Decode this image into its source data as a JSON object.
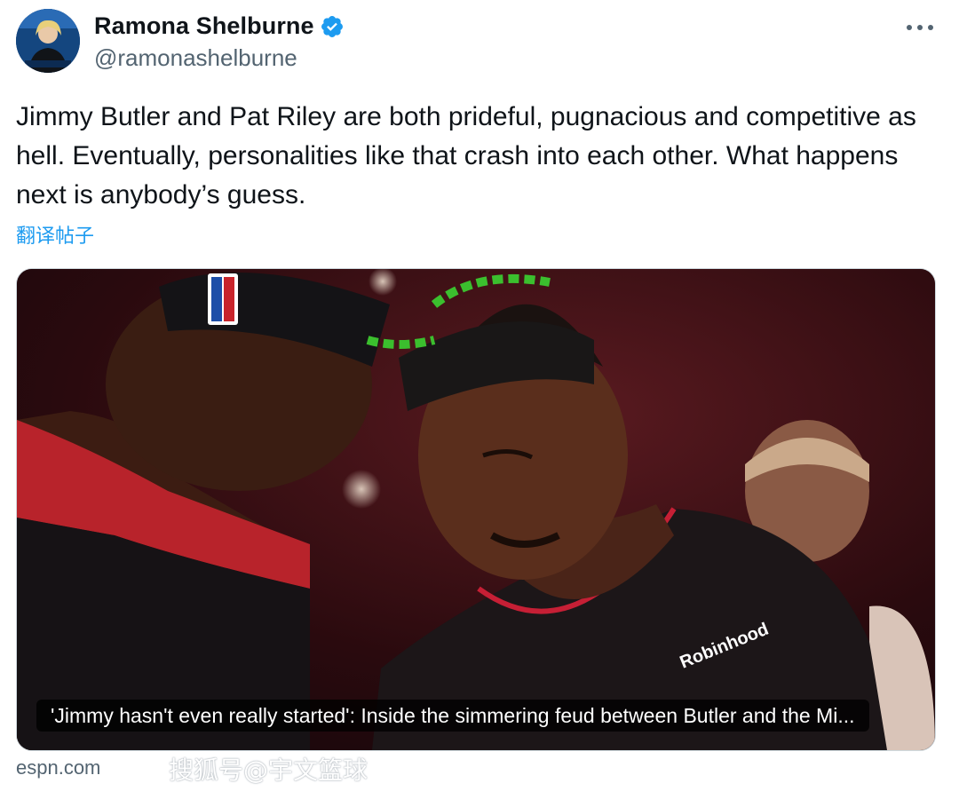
{
  "author": {
    "name": "Ramona Shelburne",
    "handle": "@ramonashelburne",
    "verified": true,
    "avatar_icon": "avatar-photo"
  },
  "more_icon": "more-horizontal-icon",
  "tweet": {
    "text": "Jimmy Butler and Pat Riley are both prideful, pugnacious and competitive as hell. Eventually, personalities like that crash into each other. What happens next is anybody’s guess.",
    "translate_label": "翻译帖子"
  },
  "card": {
    "caption": "'Jimmy hasn't even really started': Inside the simmering feud between Butler and the Mi...",
    "source": "espn.com",
    "sponsor_text": "Robinhood"
  },
  "watermark": "搜狐号@宇文篮球",
  "colors": {
    "link_blue": "#1d9bf0",
    "verified_blue": "#1d9bf0",
    "secondary_text": "#536471"
  }
}
